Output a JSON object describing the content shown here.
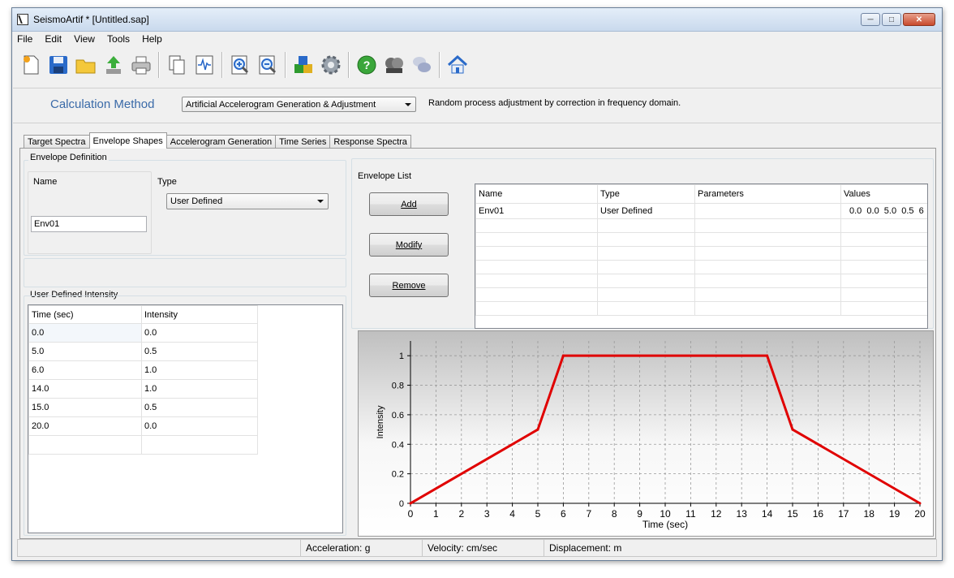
{
  "window": {
    "title": "SeismoArtif * [Untitled.sap]"
  },
  "menu": [
    "File",
    "Edit",
    "View",
    "Tools",
    "Help"
  ],
  "toolbar": {
    "icons": [
      "new-file-icon",
      "save-icon",
      "open-folder-icon",
      "export-icon",
      "print-icon",
      "copy-document-icon",
      "signal-chart-icon",
      "zoom-in-icon",
      "zoom-out-icon",
      "blocks-icon",
      "settings-gear-icon",
      "help-icon",
      "film-reel-icon",
      "chat-icon",
      "home-icon"
    ]
  },
  "calc": {
    "label": "Calculation Method",
    "selected": "Artificial Accelerogram Generation & Adjustment",
    "description": "Random process adjustment by correction in frequency domain."
  },
  "tabs": [
    "Target Spectra",
    "Envelope Shapes",
    "Accelerogram Generation",
    "Time Series",
    "Response Spectra"
  ],
  "active_tab": 1,
  "envelope_definition": {
    "group_label": "Envelope Definition",
    "name_label": "Name",
    "name_value": "Env01",
    "type_label": "Type",
    "type_value": "User Defined"
  },
  "intensity": {
    "group_label": "User Defined Intensity",
    "headers": [
      "Time (sec)",
      "Intensity"
    ],
    "rows": [
      [
        "0.0",
        "0.0"
      ],
      [
        "5.0",
        "0.5"
      ],
      [
        "6.0",
        "1.0"
      ],
      [
        "14.0",
        "1.0"
      ],
      [
        "15.0",
        "0.5"
      ],
      [
        "20.0",
        "0.0"
      ]
    ]
  },
  "envelope_list": {
    "group_label": "Envelope List",
    "buttons": {
      "add": "Add",
      "modify": "Modify",
      "remove": "Remove"
    },
    "headers": [
      "Name",
      "Type",
      "Parameters",
      "Values"
    ],
    "rows": [
      [
        "Env01",
        "User Defined",
        "",
        "0.0  0.0  5.0  0.5  6"
      ]
    ]
  },
  "chart_data": {
    "type": "line",
    "x": [
      0,
      5,
      6,
      14,
      15,
      20
    ],
    "y": [
      0,
      0.5,
      1,
      1,
      0.5,
      0
    ],
    "xlabel": "Time (sec)",
    "ylabel": "Intensity",
    "xlim": [
      0,
      20
    ],
    "ylim": [
      0,
      1.1
    ],
    "xticks": [
      "0",
      "1",
      "2",
      "3",
      "4",
      "5",
      "6",
      "7",
      "8",
      "9",
      "10",
      "11",
      "12",
      "13",
      "14",
      "15",
      "16",
      "17",
      "18",
      "19",
      "20"
    ],
    "yticks": [
      "0",
      "0.2",
      "0.4",
      "0.6",
      "0.8",
      "1"
    ],
    "grid": true,
    "line_color": "#e00000"
  },
  "status": {
    "acceleration": "Acceleration: g",
    "velocity": "Velocity: cm/sec",
    "displacement": "Displacement: m"
  }
}
